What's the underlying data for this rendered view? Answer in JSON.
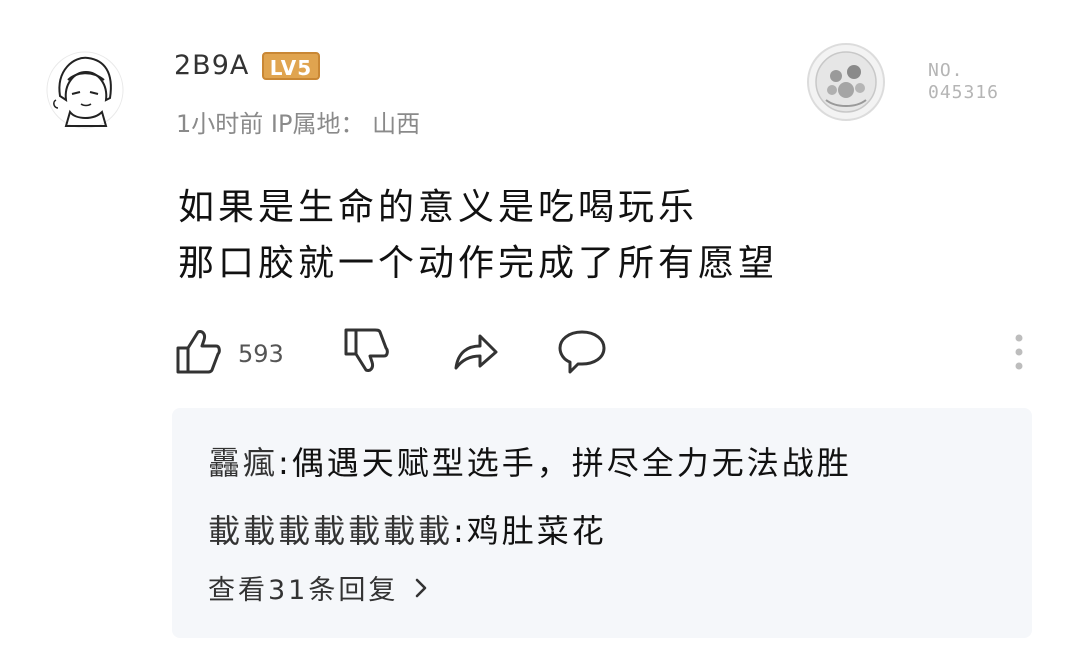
{
  "comment": {
    "username": "2B9A",
    "level_badge": "LV5",
    "time_ago": "1小时前",
    "ip_location": "IP属地： 山西",
    "medal_no_line1": "NO.",
    "medal_no_line2": "045316",
    "content_line1": "如果是生命的意义是吃喝玩乐",
    "content_line2": "那口胶就一个动作完成了所有愿望",
    "like_count": "593"
  },
  "replies": [
    {
      "name": "靐瘋",
      "sep": ":",
      "text": "偶遇天赋型选手，拼尽全力无法战胜"
    },
    {
      "name": "載載載載載載載",
      "sep": ":",
      "text": "鸡肚菜花"
    }
  ],
  "view_more": "查看31条回复",
  "icons": {
    "like": "thumbs-up-icon",
    "dislike": "thumbs-down-icon",
    "share": "share-icon",
    "comment": "comment-bubble-icon",
    "more": "more-vertical-icon",
    "chevron": "chevron-right-icon"
  },
  "colors": {
    "badge": "#e0a44f",
    "reply_bg": "#f5f7fa",
    "meta": "#8a8a8a"
  }
}
